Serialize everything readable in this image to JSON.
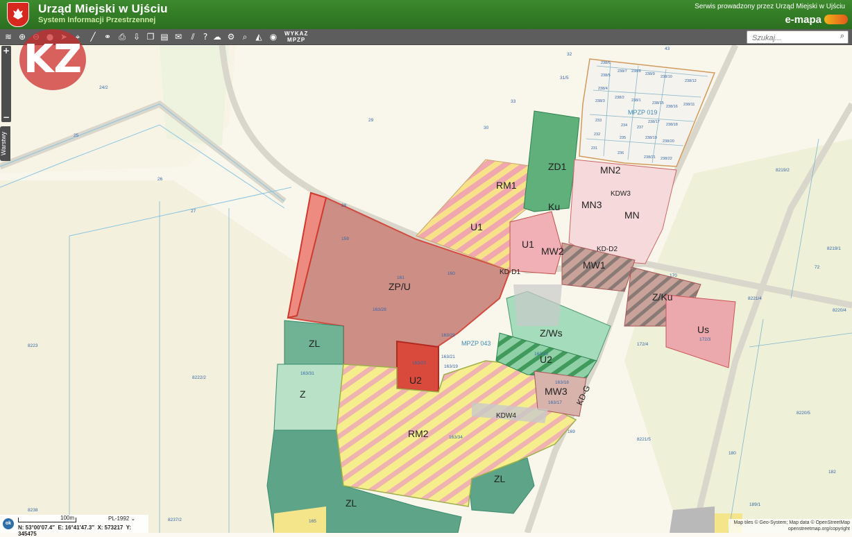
{
  "header": {
    "title": "Urząd Miejski w Ujściu",
    "subtitle": "System Informacji Przestrzennej",
    "service_note": "Serwis prowadzony przez Urząd Miejski w Ujściu",
    "brand": "e-mapa"
  },
  "toolbar": {
    "wykaz_line1": "WYKAZ",
    "wykaz_line2": "MPZP",
    "search_placeholder": "Szukaj..."
  },
  "sidebar": {
    "layers_tab": "Warstwy",
    "zoom_in": "+",
    "zoom_out": "−"
  },
  "watermark": {
    "text": "KZ"
  },
  "map": {
    "plan_labels": [
      "ZP/U",
      "U2",
      "ZL",
      "Z",
      "RM2",
      "ZL",
      "ZL",
      "RM1",
      "U1",
      "U1",
      "MW1",
      "MW2",
      "MN2",
      "MN3",
      "MN",
      "ZD1",
      "Z/Ws",
      "U2",
      "MW3",
      "Us",
      "Z/Ku",
      "Ku",
      "KD-D1",
      "KD-D2",
      "KDW4",
      "KDW3",
      "KD-G",
      "MPZP 019",
      "MPZP 043"
    ],
    "parcels": [
      "43",
      "32",
      "31/5",
      "24/2",
      "33",
      "29",
      "30",
      "25",
      "26",
      "27",
      "28",
      "159",
      "161",
      "160",
      "163/28",
      "163/23",
      "163/31",
      "163/34",
      "163/29",
      "163/21",
      "163/19",
      "163/15",
      "163/18",
      "163/17",
      "165",
      "169",
      "170",
      "172/4",
      "172/3",
      "8219/2",
      "8219/1",
      "72",
      "8221/4",
      "8220/4",
      "8223",
      "8222/2",
      "8220/5",
      "8221/5",
      "180",
      "182",
      "189/1",
      "8237/2",
      "8238",
      "238/6",
      "238/5",
      "238/4",
      "238/3",
      "238/7",
      "238/8",
      "238/9",
      "238/10",
      "238/12",
      "238/2",
      "238/1",
      "238/15",
      "238/16",
      "238/11",
      "238/17",
      "238/18",
      "238/19",
      "238/20",
      "238/21",
      "238/22",
      "233",
      "232",
      "231",
      "234",
      "235",
      "236",
      "237"
    ]
  },
  "bottom": {
    "scale_label": "100m",
    "crs": "PL-1992",
    "coord_n": "N: 53°00′07.4″",
    "coord_e": "E: 16°41′47.3″",
    "coord_x": "X: 573217",
    "coord_y": "Y: 345475",
    "ok_label": "ok"
  },
  "attribution": {
    "line1": "Map tiles © Geo-System; Map data © OpenStreetMap",
    "line2": "openstreetmap.org/copyright"
  }
}
